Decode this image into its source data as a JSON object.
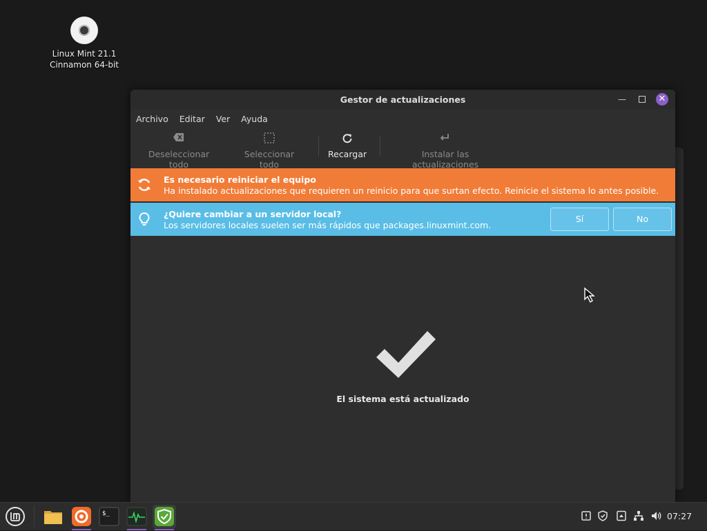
{
  "desktop": {
    "icon_label_line1": "Linux Mint 21.1",
    "icon_label_line2": "Cinnamon 64-bit"
  },
  "window": {
    "title": "Gestor de actualizaciones",
    "close_glyph": "✕",
    "minimize_glyph": "—"
  },
  "menu": [
    "Archivo",
    "Editar",
    "Ver",
    "Ayuda"
  ],
  "toolbar": {
    "deselect_all": "Deseleccionar todo",
    "select_all": "Seleccionar todo",
    "reload": "Recargar",
    "install": "Instalar las actualizaciones"
  },
  "reboot_banner": {
    "title": "Es necesario reiniciar el equipo",
    "text": "Ha instalado actualizaciones que requieren un reinicio para que surtan efecto. Reinicie el sistema lo antes posible.",
    "color": "#f17c38"
  },
  "mirror_banner": {
    "title": "¿Quiere cambiar a un servidor local?",
    "text": "Los servidores locales suelen ser más rápidos que packages.linuxmint.com.",
    "yes_label": "Sí",
    "no_label": "No",
    "color": "#59bde6"
  },
  "status": {
    "message": "El sistema está actualizado"
  },
  "taskbar": {
    "apps": [
      "files-icon",
      "firefox-icon",
      "terminal-icon",
      "system-monitor-icon",
      "update-manager-icon"
    ],
    "tray": [
      "notifications-icon",
      "shield-icon",
      "removable-drive-icon",
      "network-icon",
      "volume-icon"
    ],
    "clock": "07:27"
  },
  "colors": {
    "accent": "#8a5fc7",
    "window_bg": "#2e2e2e"
  }
}
